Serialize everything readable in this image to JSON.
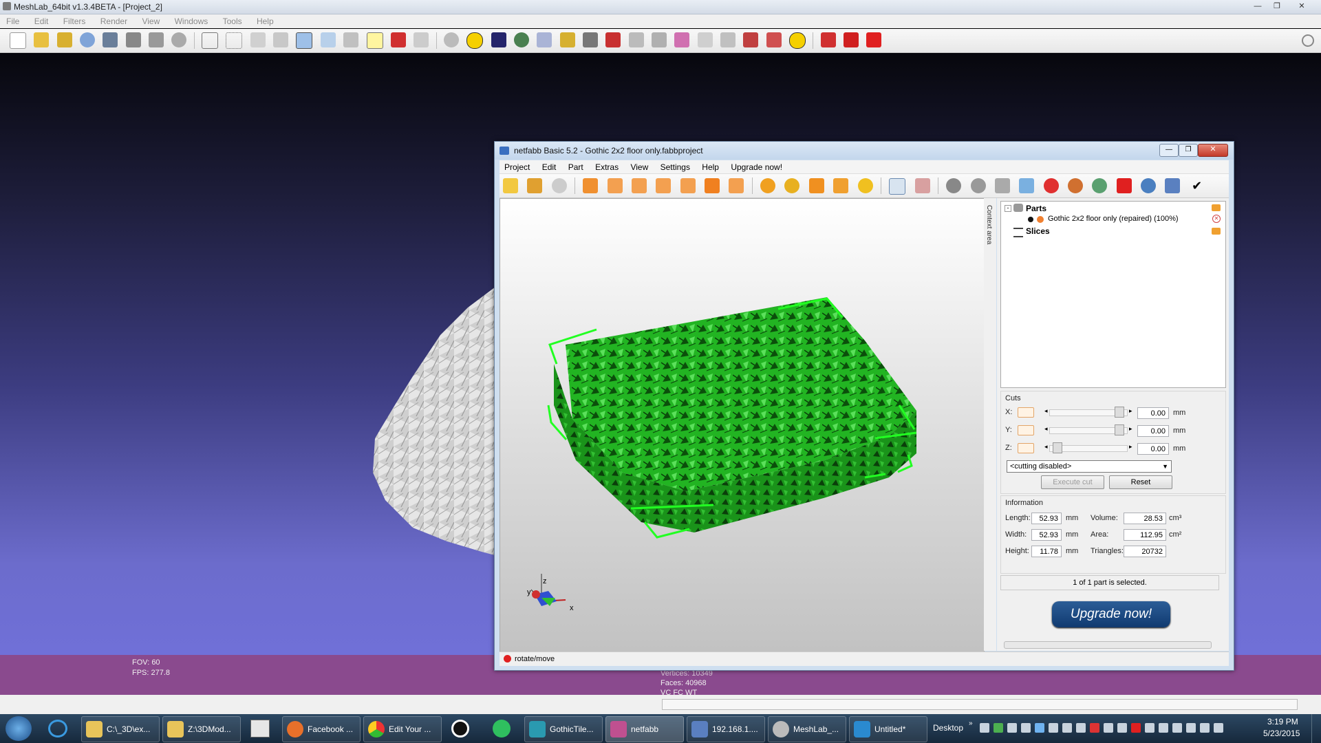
{
  "meshlab": {
    "title": "MeshLab_64bit v1.3.4BETA - [Project_2]",
    "menu": [
      "File",
      "Edit",
      "Filters",
      "Render",
      "View",
      "Windows",
      "Tools",
      "Help"
    ],
    "fov": "FOV: 60",
    "fps": "FPS:   277.8",
    "vertices": "Vertices: 10349",
    "faces": "Faces: 40968",
    "vc": "VC FC WT"
  },
  "netfabb": {
    "title": "netfabb Basic 5.2 - Gothic 2x2 floor only.fabbproject",
    "menu": [
      "Project",
      "Edit",
      "Part",
      "Extras",
      "View",
      "Settings",
      "Help",
      "Upgrade now!"
    ],
    "context_label": "Context area",
    "tree": {
      "parts": "Parts",
      "part_item": "Gothic 2x2 floor only (repaired) (100%)",
      "slices": "Slices"
    },
    "axis": {
      "x": "x",
      "y": "y",
      "z": "z"
    },
    "cuts": {
      "title": "Cuts",
      "rows": [
        {
          "axis": "X:",
          "value": "0.00",
          "unit": "mm",
          "pos": 0.95
        },
        {
          "axis": "Y:",
          "value": "0.00",
          "unit": "mm",
          "pos": 0.95
        },
        {
          "axis": "Z:",
          "value": "0.00",
          "unit": "mm",
          "pos": 0.05
        }
      ],
      "dropdown": "<cutting disabled>",
      "execute": "Execute cut",
      "reset": "Reset"
    },
    "info": {
      "title": "Information",
      "length_label": "Length:",
      "length": "52.93",
      "length_unit": "mm",
      "width_label": "Width:",
      "width": "52.93",
      "width_unit": "mm",
      "height_label": "Height:",
      "height": "11.78",
      "height_unit": "mm",
      "volume_label": "Volume:",
      "volume": "28.53",
      "volume_unit": "cm³",
      "area_label": "Area:",
      "area": "112.95",
      "area_unit": "cm²",
      "triangles_label": "Triangles:",
      "triangles": "20732"
    },
    "selection": "1 of 1 part is selected.",
    "upgrade_button": "Upgrade now!",
    "status": "rotate/move"
  },
  "taskbar": {
    "items": [
      "C:\\_3D\\ex...",
      "Z:\\3DMod...",
      "Facebook ...",
      "Edit Your ...",
      "GothicTile...",
      "netfabb",
      "192.168.1....",
      "MeshLab_...",
      "Untitled*"
    ],
    "desktop": "Desktop",
    "time": "3:19 PM",
    "date": "5/23/2015"
  },
  "colors": {
    "accent": "#1f4f8a",
    "mesh": "#1fbf1f",
    "bbox": "#2bff2b",
    "purple": "#8a4a8e"
  }
}
